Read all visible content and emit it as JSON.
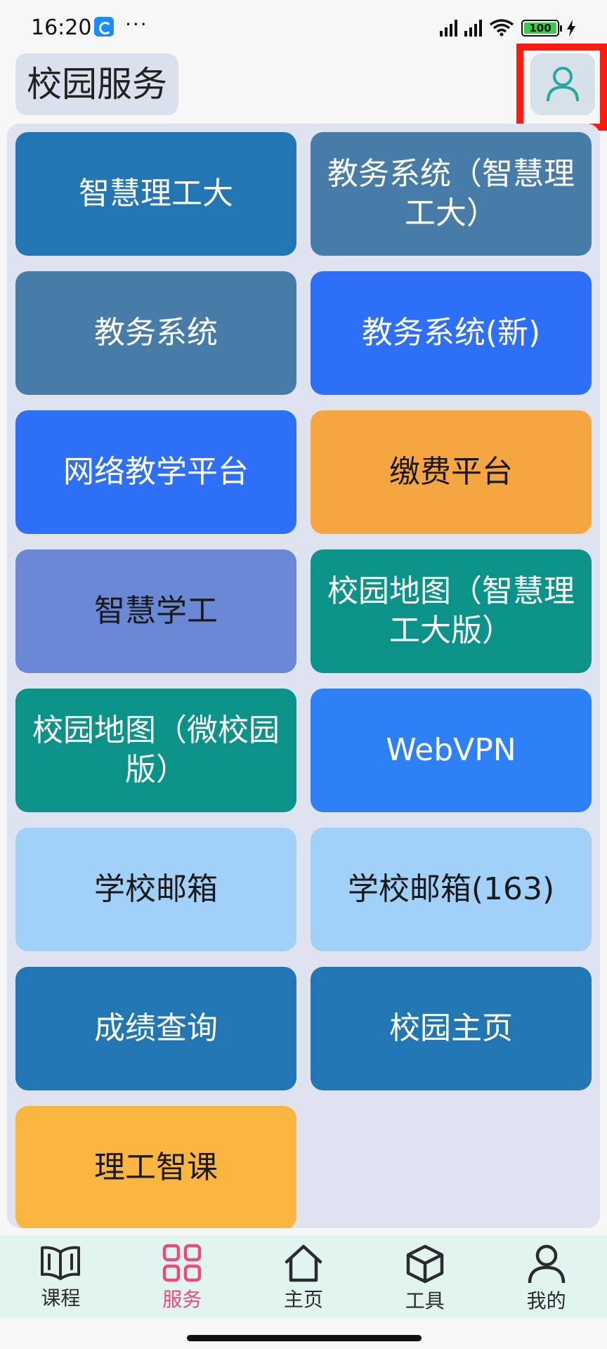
{
  "status_bar": {
    "time": "16:20",
    "app_icon": "browser-app-icon",
    "more": "···",
    "battery": "100",
    "signal_icons": [
      "cell-signal-icon",
      "cell-signal-icon",
      "wifi-icon",
      "charging-bolt-icon"
    ]
  },
  "header": {
    "title": "校园服务",
    "profile_icon": "person-icon"
  },
  "tiles": [
    {
      "label": "智慧理工大",
      "color": "#2176b3",
      "text_color": "#ffffff"
    },
    {
      "label": "教务系统（智慧理工大）",
      "color": "#477ca8",
      "text_color": "#ffffff"
    },
    {
      "label": "教务系统",
      "color": "#477ca8",
      "text_color": "#ffffff"
    },
    {
      "label": "教务系统(新)",
      "color": "#2e6ff7",
      "text_color": "#ffffff"
    },
    {
      "label": "网络教学平台",
      "color": "#2e6ff7",
      "text_color": "#ffffff"
    },
    {
      "label": "缴费平台",
      "color": "#f6a640",
      "text_color": "#1a1a1a"
    },
    {
      "label": "智慧学工",
      "color": "#6a88d6",
      "text_color": "#1a1a1a"
    },
    {
      "label": "校园地图（智慧理工大版）",
      "color": "#0b9289",
      "text_color": "#ffffff"
    },
    {
      "label": "校园地图（微校园版）",
      "color": "#0b9289",
      "text_color": "#ffffff"
    },
    {
      "label": "WebVPN",
      "color": "#2e80f7",
      "text_color": "#ffffff"
    },
    {
      "label": "学校邮箱",
      "color": "#a1d1f9",
      "text_color": "#1a1a1a"
    },
    {
      "label": "学校邮箱(163)",
      "color": "#a1d1f9",
      "text_color": "#1a1a1a"
    },
    {
      "label": "成绩查询",
      "color": "#2176b3",
      "text_color": "#ffffff"
    },
    {
      "label": "校园主页",
      "color": "#2176b3",
      "text_color": "#ffffff"
    },
    {
      "label": "理工智课",
      "color": "#fab640",
      "text_color": "#1a1a1a"
    }
  ],
  "bottom_nav": [
    {
      "label": "课程",
      "icon": "book-icon",
      "active": false
    },
    {
      "label": "服务",
      "icon": "grid-icon",
      "active": true
    },
    {
      "label": "主页",
      "icon": "home-icon",
      "active": false
    },
    {
      "label": "工具",
      "icon": "cube-icon",
      "active": false
    },
    {
      "label": "我的",
      "icon": "person-icon",
      "active": false
    }
  ],
  "colors": {
    "accent_active": "#ec4a7d",
    "highlight_box": "#ff1a10",
    "nav_background": "#e1f4f0",
    "panel_background": "#dfe3ef"
  }
}
